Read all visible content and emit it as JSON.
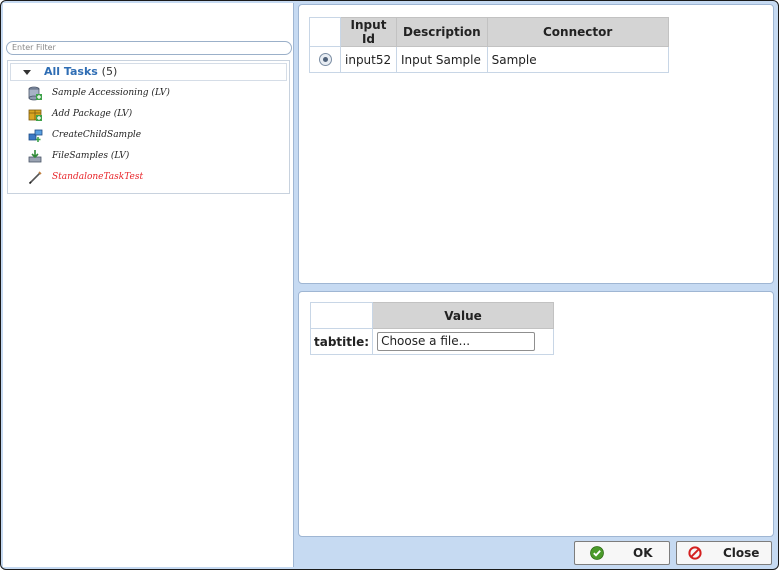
{
  "filter": {
    "placeholder": "Enter Filter"
  },
  "tree": {
    "root_label": "All Tasks",
    "root_count": "(5)",
    "items": [
      {
        "label": "Sample Accessioning (LV)",
        "icon": "database-icon"
      },
      {
        "label": "Add Package (LV)",
        "icon": "package-icon"
      },
      {
        "label": "CreateChildSample",
        "icon": "child-sample-icon"
      },
      {
        "label": "FileSamples (LV)",
        "icon": "file-samples-icon"
      },
      {
        "label": "StandaloneTaskTest",
        "icon": "pencil-icon",
        "color": "#e8252a"
      }
    ]
  },
  "inputs_table": {
    "headers": [
      "Input Id",
      "Description",
      "Connector"
    ],
    "rows": [
      {
        "id": "input52",
        "description": "Input Sample",
        "connector": "Sample"
      }
    ]
  },
  "value_table": {
    "header": "Value",
    "row_label": "tabtitle:",
    "file_text": "Choose a file..."
  },
  "buttons": {
    "ok": "OK",
    "close": "Close"
  },
  "colors": {
    "ok_green": "#4a9a2a",
    "close_red": "#d42020",
    "accent_blue": "#2e6db4"
  }
}
